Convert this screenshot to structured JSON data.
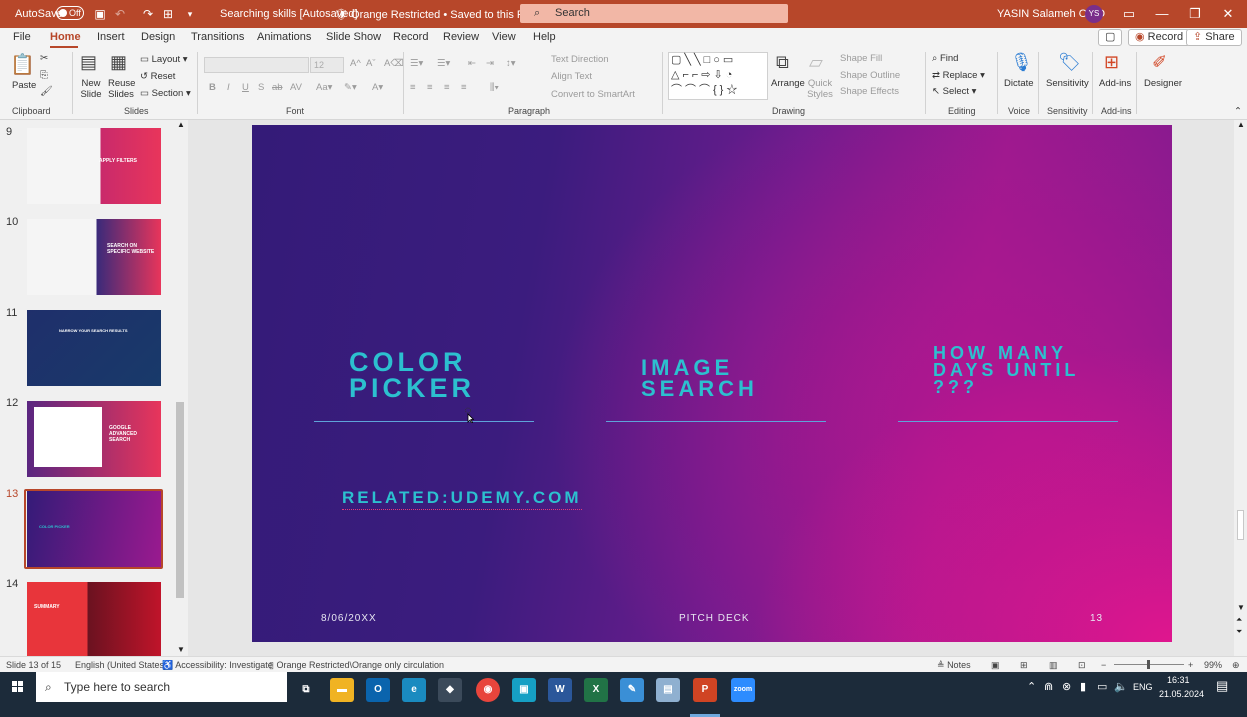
{
  "titlebar": {
    "autosave_label": "AutoSave",
    "autosave_state": "Off",
    "doc_title": "Searching skills [Autosaved]",
    "sensitivity_status": "Orange Restricted • Saved to this PC",
    "search_placeholder": "Search",
    "user_name": "YASIN Salameh O-JO",
    "user_initials": "YS"
  },
  "menu": {
    "tabs": [
      "File",
      "Home",
      "Insert",
      "Design",
      "Transitions",
      "Animations",
      "Slide Show",
      "Record",
      "Review",
      "View",
      "Help"
    ],
    "active": "Home",
    "record_btn": "Record",
    "share_btn": "Share"
  },
  "ribbon": {
    "groups": [
      "Clipboard",
      "Slides",
      "Font",
      "Paragraph",
      "Drawing",
      "Editing",
      "Voice",
      "Sensitivity",
      "Add-ins"
    ],
    "paste": "Paste",
    "new_slide": "New Slide",
    "reuse_slides": "Reuse Slides",
    "layout": "Layout",
    "reset": "Reset",
    "section": "Section",
    "font_size": "12",
    "text_direction": "Text Direction",
    "align_text": "Align Text",
    "convert_smartart": "Convert to SmartArt",
    "arrange": "Arrange",
    "quick_styles": "Quick Styles",
    "shape_fill": "Shape Fill",
    "shape_outline": "Shape Outline",
    "shape_effects": "Shape Effects",
    "find": "Find",
    "replace": "Replace",
    "select": "Select",
    "dictate": "Dictate",
    "sensitivity": "Sensitivity",
    "addins": "Add-ins",
    "designer": "Designer"
  },
  "thumbnails": [
    {
      "num": "9",
      "title": "APPLY FILTERS"
    },
    {
      "num": "10",
      "title": "SEARCH ON SPECIFIC WEBSITE"
    },
    {
      "num": "11",
      "title": "NARROW YOUR SEARCH RESULTS"
    },
    {
      "num": "12",
      "title": "GOOGLE ADVANCED SEARCH"
    },
    {
      "num": "13",
      "title": "COLOR PICKER"
    },
    {
      "num": "14",
      "title": "SUMMARY"
    }
  ],
  "slide": {
    "title1": "COLOR\nPICKER",
    "title2": "IMAGE\nSEARCH",
    "title3": "HOW MANY\nDAYS UNTIL\n???",
    "link": "RELATED:UDEMY.COM",
    "date": "8/06/20XX",
    "footer": "PITCH DECK",
    "page": "13"
  },
  "status": {
    "slide_info": "Slide 13 of 15",
    "language": "English (United States)",
    "accessibility": "Accessibility: Investigate",
    "sensitivity": "Orange Restricted\\Orange only circulation",
    "notes": "Notes",
    "zoom": "99%"
  },
  "taskbar": {
    "search_placeholder": "Type here to search",
    "lang": "ENG",
    "time": "16:31",
    "date": "21.05.2024",
    "apps": [
      "file-explorer",
      "outlook",
      "edge",
      "unknown-app",
      "chrome",
      "teams-app",
      "word",
      "excel",
      "paint",
      "notepad",
      "powerpoint",
      "zoom"
    ]
  },
  "colors": {
    "accent": "#b7472a",
    "slide_title": "#2cc0cf",
    "taskbar": "#1c2b3a"
  }
}
